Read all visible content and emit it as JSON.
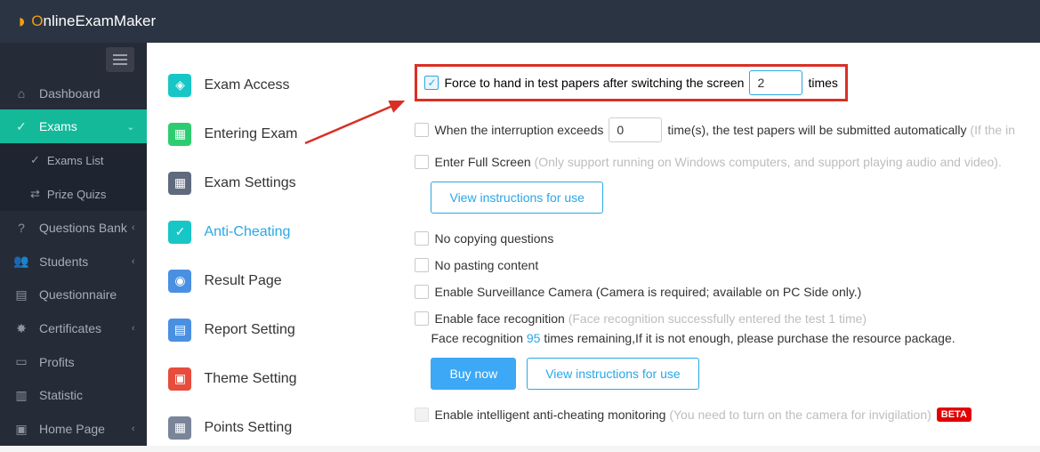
{
  "brand": {
    "name": "OnlineExamMaker"
  },
  "sidebar": {
    "items": [
      {
        "label": "Dashboard"
      },
      {
        "label": "Exams"
      },
      {
        "label": "Questions Bank"
      },
      {
        "label": "Students"
      },
      {
        "label": "Questionnaire"
      },
      {
        "label": "Certificates"
      },
      {
        "label": "Profits"
      },
      {
        "label": "Statistic"
      },
      {
        "label": "Home Page"
      }
    ],
    "exams_sub": [
      {
        "label": "Exams List"
      },
      {
        "label": "Prize Quizs"
      }
    ]
  },
  "tabs": [
    {
      "label": "Exam Access"
    },
    {
      "label": "Entering Exam"
    },
    {
      "label": "Exam Settings"
    },
    {
      "label": "Anti-Cheating"
    },
    {
      "label": "Result Page"
    },
    {
      "label": "Report Setting"
    },
    {
      "label": "Theme Setting"
    },
    {
      "label": "Points Setting"
    }
  ],
  "anti": {
    "force_label_a": "Force to hand in test papers after switching the screen",
    "force_value": "2",
    "force_label_b": "times",
    "interrupt_a": "When the interruption exceeds",
    "interrupt_value": "0",
    "interrupt_b": "time(s), the test papers will be submitted automatically",
    "interrupt_hint": "(If the in",
    "fullscreen": "Enter Full Screen",
    "fullscreen_hint": "(Only support running on Windows computers, and support playing audio and video).",
    "view_instr": "View instructions for use",
    "no_copy": "No copying questions",
    "no_paste": "No pasting content",
    "camera": "Enable Surveillance Camera (Camera is required;  available on PC Side only.)",
    "face_a": "Enable face recognition",
    "face_hint": "(Face recognition successfully entered the test 1 time)",
    "face_remain_a": "Face recognition ",
    "face_remain_n": "95",
    "face_remain_b": " times remaining,If it is not enough, please purchase the resource package.",
    "buy_now": "Buy now",
    "intel_a": "Enable intelligent anti-cheating monitoring",
    "intel_hint": "(You need to turn on the camera for invigilation)",
    "beta": "BETA"
  }
}
